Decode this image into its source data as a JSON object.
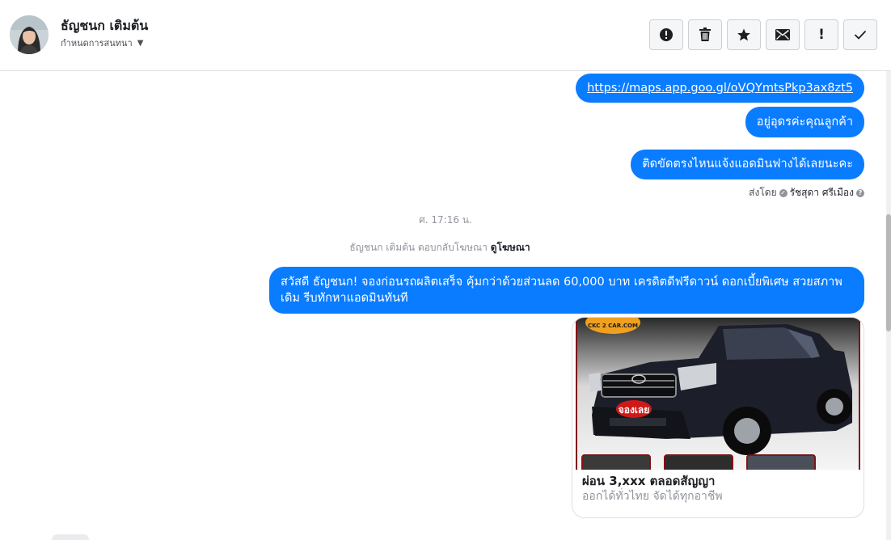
{
  "header": {
    "contact_name": "ธัญชนก เติมต้น",
    "assign_label": "กำหนดการสนทนา"
  },
  "toolbar": {
    "buttons": [
      {
        "name": "report-spam-button",
        "icon": "exclamation-circle-icon"
      },
      {
        "name": "delete-button",
        "icon": "trash-icon"
      },
      {
        "name": "star-button",
        "icon": "star-icon"
      },
      {
        "name": "mark-unread-button",
        "icon": "envelope-icon"
      },
      {
        "name": "mark-important-button",
        "icon": "exclamation-icon",
        "glyph": "!"
      },
      {
        "name": "done-button",
        "icon": "checkmark-icon"
      }
    ]
  },
  "messages": {
    "link_text": "https://maps.app.goo.gl/oVQYmtsPkp3ax8zt5",
    "msg_location": "อยู่อุดรค่ะคุณลูกค้า",
    "msg_help": "ติดขัดตรงไหนแจ้งแอดมินฟางได้เลยนะคะ",
    "sent_by_prefix": "ส่งโดย",
    "sent_by_name": "รัชสุดา ศรีเมือง",
    "timestamp": "ศ. 17:16 น.",
    "ad_reply_text": "ธัญชนก เติมต้น ตอบกลับโฆษณา",
    "ad_reply_link": "ดูโฆษณา",
    "promo_text": "สวัสดี ธัญชนก! จองก่อนรถผลิตเสร็จ คุ้มกว่าด้วยส่วนลด 60,000 บาท เครดิตดีฟรีดาวน์ ดอกเบี้ยพิเศษ สวยสภาพเดิม รีบทักหาแอดมินทันที"
  },
  "ad_card": {
    "logo_text": "CKC 2 CAR.COM",
    "image_stamp": "จองเลย",
    "title": "ผ่อน 3,xxx ตลอดสัญญา",
    "description": "ออกได้ทั่วไทย จัดได้ทุกอาชีพ"
  },
  "colors": {
    "bubble": "#0a7cff",
    "border": "#dddfe2",
    "muted_text": "#90949c"
  }
}
